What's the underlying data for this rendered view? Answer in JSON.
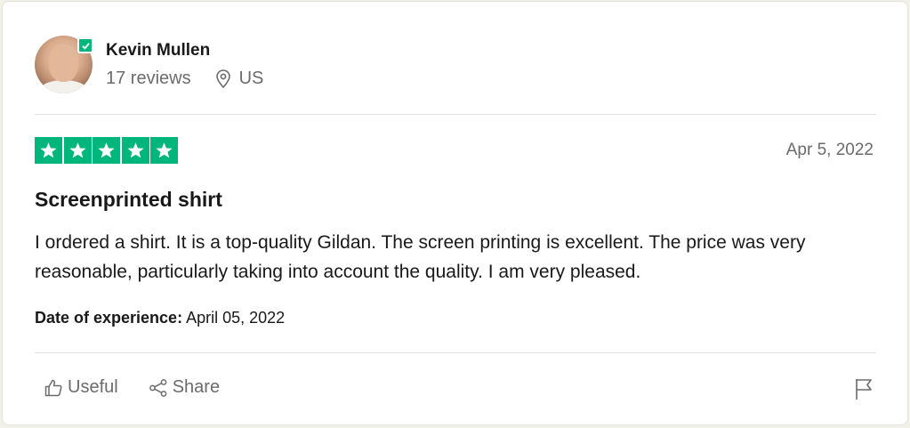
{
  "reviewer": {
    "name": "Kevin Mullen",
    "reviews_count": "17 reviews",
    "location": "US",
    "verified": true
  },
  "review": {
    "rating": 5,
    "rating_max": 5,
    "date": "Apr 5, 2022",
    "title": "Screenprinted shirt",
    "body": "I ordered a shirt. It is a top-quality Gildan. The screen printing is excellent. The price was very reasonable, particularly taking into account the quality. I am very pleased.",
    "experience_label": "Date of experience:",
    "experience_date": "April 05, 2022"
  },
  "actions": {
    "useful_label": "Useful",
    "share_label": "Share"
  },
  "icons": {
    "verified": "check-badge-icon",
    "location": "map-pin-icon",
    "star": "star-icon",
    "useful": "thumbs-up-icon",
    "share": "share-icon",
    "flag": "flag-icon"
  },
  "colors": {
    "star_green": "#00b67a",
    "text_primary": "#191919",
    "text_secondary": "#6b6b6b"
  }
}
